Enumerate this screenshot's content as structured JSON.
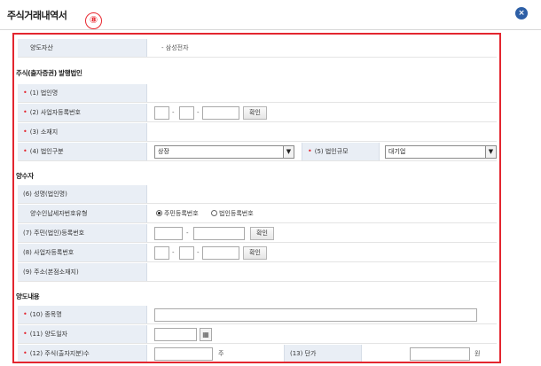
{
  "window": {
    "title": "주식거래내역서",
    "step_badge": "⑧",
    "close_icon": "×"
  },
  "transfer_asset": {
    "label": "양도자산",
    "value": "- 삼성전자"
  },
  "issuer": {
    "section": "주식(출자증권) 발행법인",
    "corp_name_label": "(1) 법인명",
    "biz_reg_label": "(2) 사업자등록번호",
    "confirm_button": "확인",
    "address_label": "(3) 소재지",
    "corp_type_label": "(4) 법인구분",
    "corp_type_value": "상장",
    "corp_size_label": "(5) 법인규모",
    "corp_size_value": "대기업"
  },
  "transferee": {
    "section": "양수자",
    "name_label": "(6) 성명(법인명)",
    "id_type_label": "양수인납세자번호유형",
    "id_type_options": [
      "주민등록번호",
      "법인등록번호"
    ],
    "resident_no_label": "(7) 주민(법인)등록번호",
    "confirm_button": "확인",
    "biz_reg_label": "(8) 사업자등록번호",
    "confirm_button_2": "확인",
    "address_label": "(9) 주소(본점소재지)"
  },
  "transfer": {
    "section": "양도내용",
    "item_name_label": "(10) 종목명",
    "date_label": "(11) 양도일자",
    "calendar_icon": "▦",
    "shares_label": "(12) 주식(출자지분)수",
    "shares_unit": "주",
    "unit_price_label": "(13) 단가",
    "price_unit": "원"
  },
  "colors": {
    "highlight": "#e3262f",
    "label_bg": "#e9eef5",
    "close_btn": "#2d5fa6"
  }
}
